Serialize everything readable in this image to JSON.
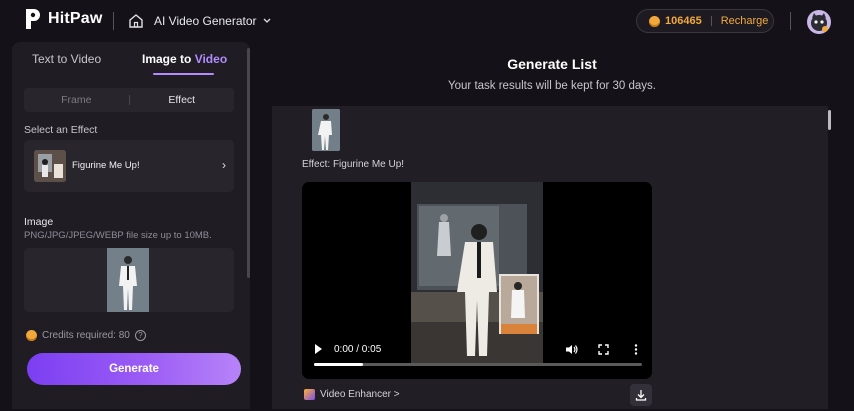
{
  "header": {
    "brand": "HitPaw",
    "product": "AI Video Generator",
    "credits": "106465",
    "recharge": "Recharge"
  },
  "left": {
    "tabs": [
      "Text to Video",
      "Image to ",
      "Video"
    ],
    "segment": [
      "Frame",
      "Effect"
    ],
    "select_label": "Select an Effect",
    "effect_name": "Figurine Me Up!",
    "image_label": "Image",
    "image_hint": "PNG/JPG/JPEG/WEBP file size up to 10MB.",
    "credits_required": "Credits required: 80",
    "help": "?",
    "generate": "Generate"
  },
  "main": {
    "title": "Generate List",
    "subtitle": "Your task results will be kept for 30 days.",
    "effect_line": "Effect: Figurine Me Up!",
    "time": "0:00 / 0:05",
    "progress": 0.15,
    "enhancer": "Video Enhancer >"
  },
  "colors": {
    "accent": "#b28cff",
    "gold": "#f2a93b"
  }
}
